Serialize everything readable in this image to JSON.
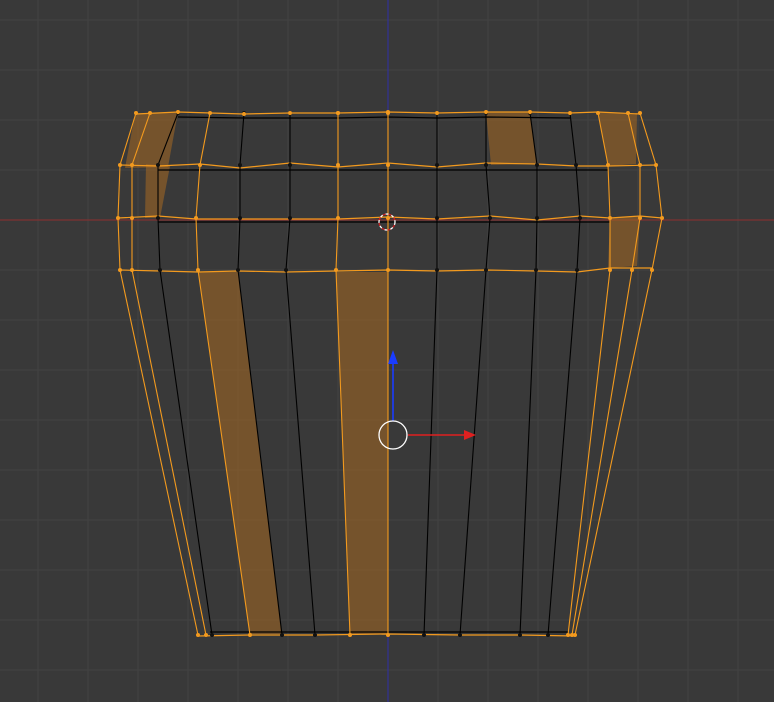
{
  "viewport": {
    "view": "front-orthographic",
    "mode": "edit-mode",
    "background_color": "#393939",
    "grid_color": "#424242",
    "x_axis_color": "#8f2f2f",
    "z_axis_color": "#2f2fa8"
  },
  "mesh": {
    "object": "bucket",
    "wire_color": "#000000",
    "selected_color": "#f39a1e",
    "selected_face_fill": "#e08a1c"
  },
  "widgets": {
    "manipulator_x_color": "#e02020",
    "manipulator_z_color": "#1a3cff",
    "pivot_icon": "pivot-circle-icon",
    "cursor_icon": "3d-cursor-icon"
  }
}
